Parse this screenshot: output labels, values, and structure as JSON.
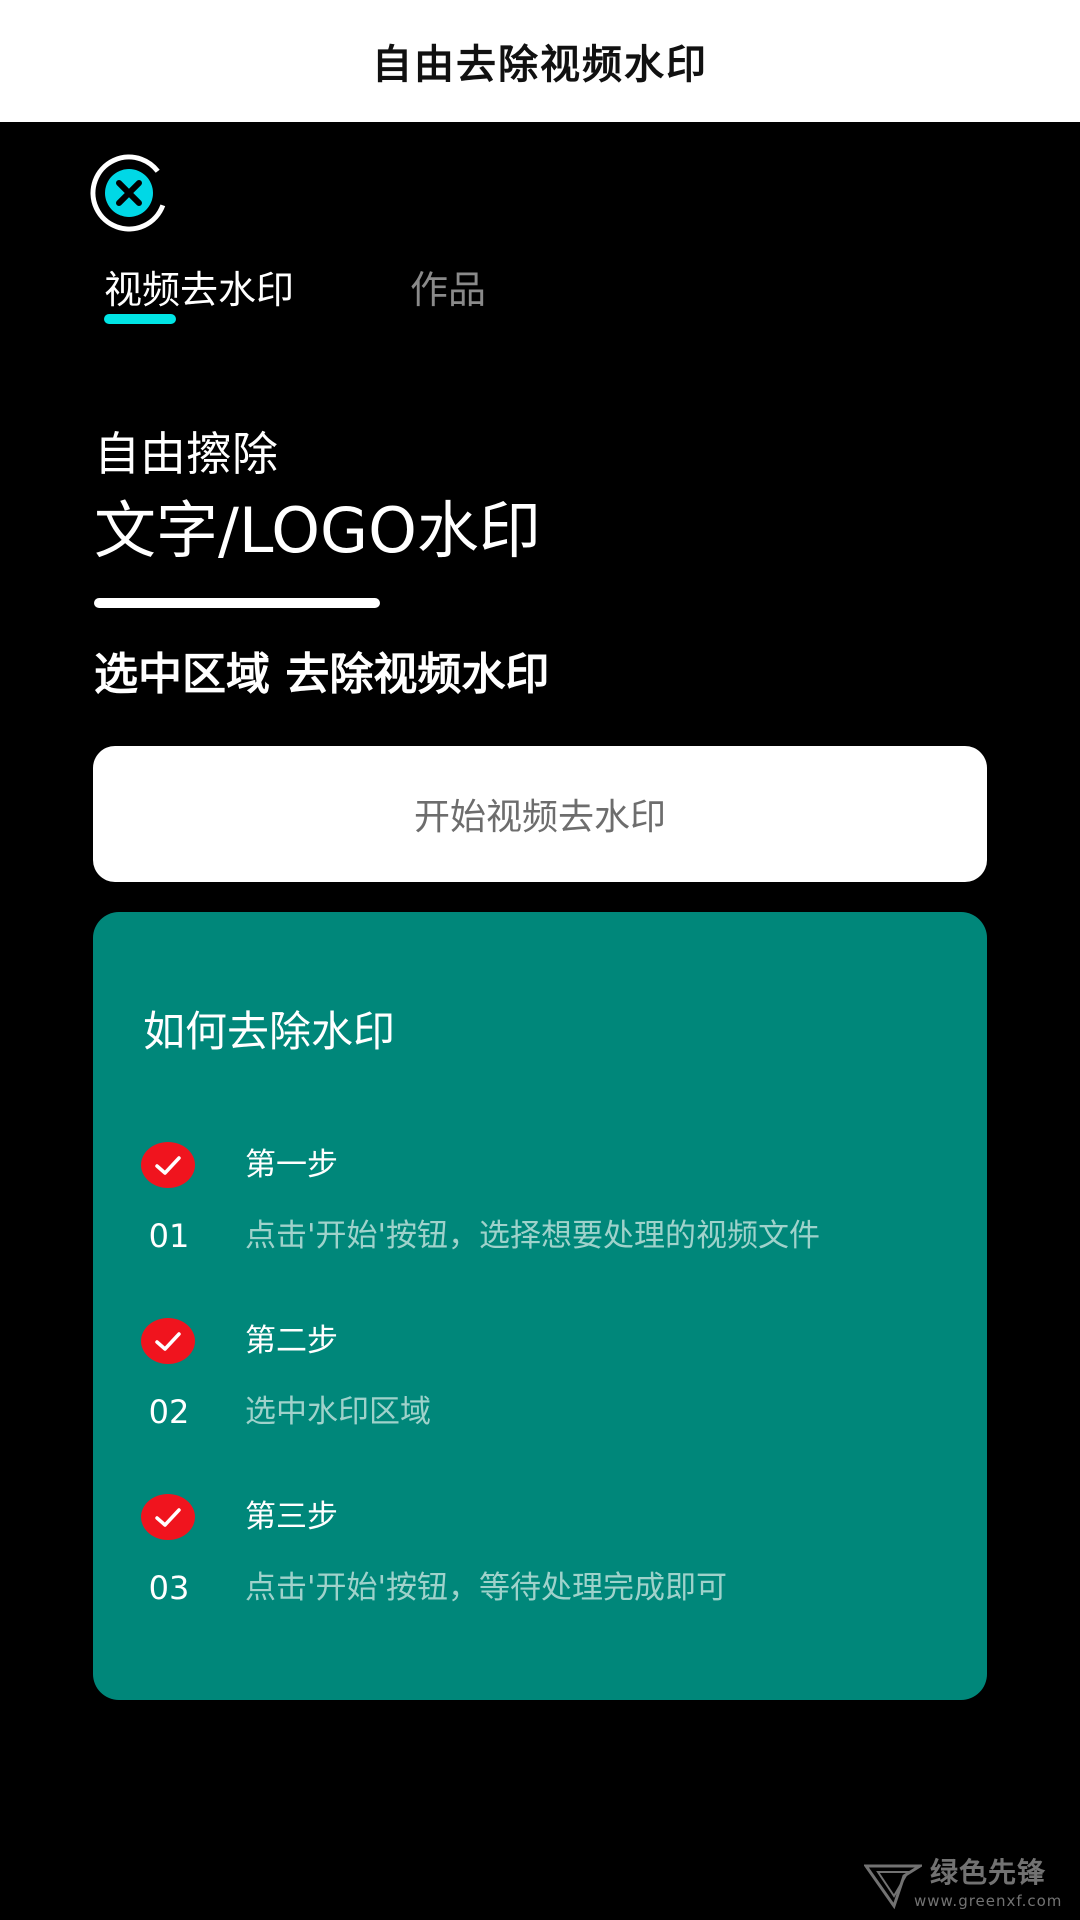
{
  "banner": {
    "title": "自由去除视频水印"
  },
  "app": {
    "close_icon": "close-circle-icon"
  },
  "tabs": [
    {
      "label": "视频去水印",
      "active": true
    },
    {
      "label": "作品",
      "active": false
    }
  ],
  "hero": {
    "line1": "自由擦除",
    "line2": "文字/LOGO水印",
    "subtitle": "选中区域 去除视频水印"
  },
  "start_button": {
    "label": "开始视频去水印"
  },
  "howto": {
    "title": "如何去除水印",
    "steps": [
      {
        "title": "第一步",
        "number": "01",
        "description": "点击'开始'按钮，选择想要处理的视频文件"
      },
      {
        "title": "第二步",
        "number": "02",
        "description": "选中水印区域"
      },
      {
        "title": "第三步",
        "number": "03",
        "description": "点击'开始'按钮，等待处理完成即可"
      }
    ]
  },
  "watermark": {
    "text": "绿色先锋",
    "url": "www.greenxf.com"
  },
  "colors": {
    "accent_cyan": "#00e5e5",
    "card_teal": "#00877a",
    "check_red": "#f0141e",
    "step_desc": "#9fd2cb"
  }
}
